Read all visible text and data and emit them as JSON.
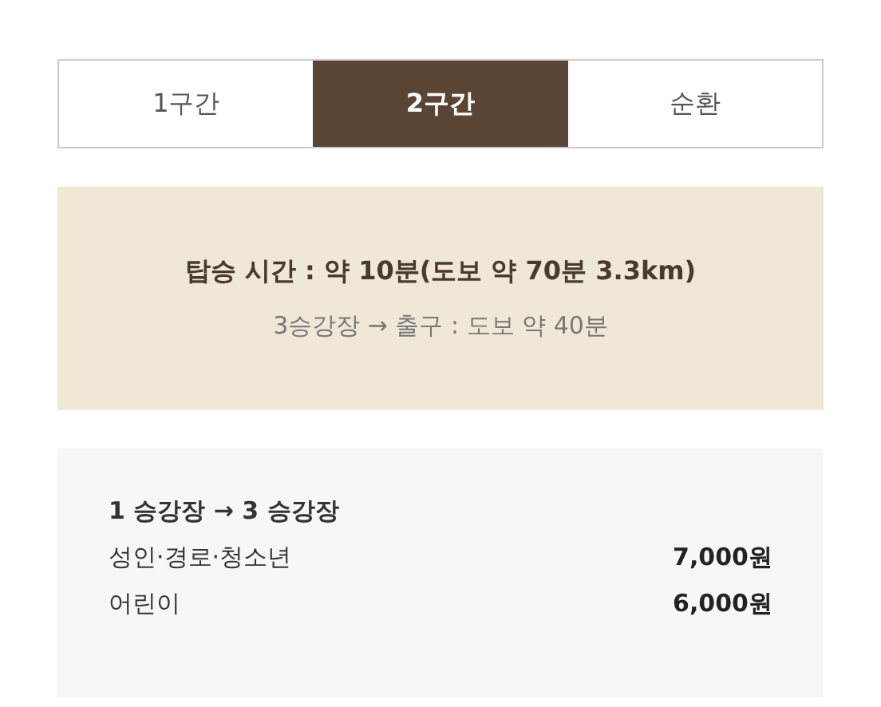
{
  "tabs": [
    {
      "label": "1구간",
      "selected": false
    },
    {
      "label": "2구간",
      "selected": true
    },
    {
      "label": "순환",
      "selected": false
    }
  ],
  "info": {
    "title": "탑승 시간 : 약 10분(도보 약 70분 3.3km)",
    "note": "3승강장 → 출구 : 도보 약 40분"
  },
  "fares": {
    "route": "1 승강장 → 3 승강장",
    "rows": [
      {
        "label": "성인·경로·청소년",
        "price": "7,000원"
      },
      {
        "label": "어린이",
        "price": "6,000원"
      }
    ]
  }
}
